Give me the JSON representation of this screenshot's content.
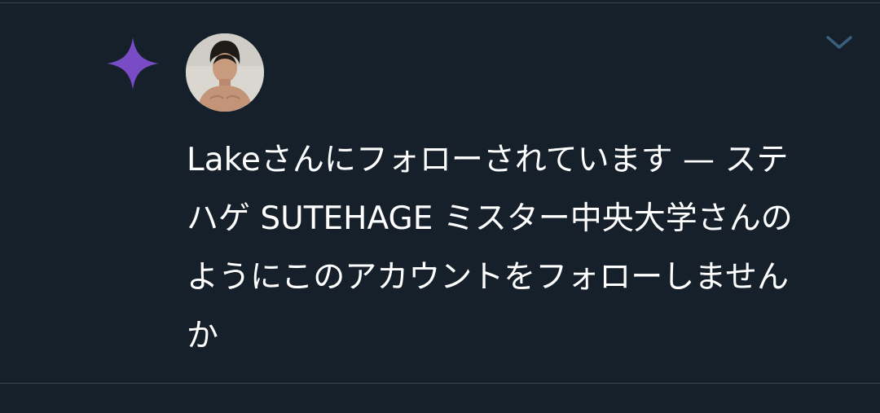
{
  "notification": {
    "icon": "sparkle-icon",
    "icon_color": "#794bc4",
    "avatar": "user-avatar-photo",
    "menu_icon": "chevron-down-icon",
    "menu_icon_color": "#3a5f7a",
    "text": "Lakeさんにフォローされています — ステハゲ SUTEHAGE ミスター中央大学さんのようにこのアカウントをフォローしませんか"
  },
  "theme": {
    "background": "#15202b",
    "divider": "#38444d",
    "text_color": "#ffffff"
  }
}
